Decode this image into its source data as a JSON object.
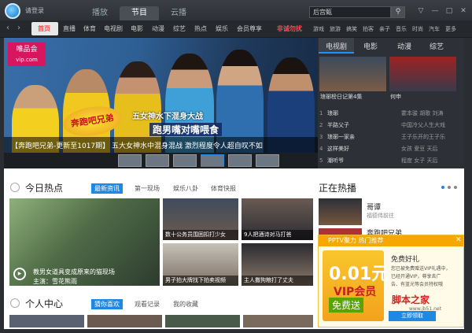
{
  "titlebar": {
    "login": "请登录",
    "tabs": [
      {
        "label": "播放",
        "active": false
      },
      {
        "label": "节目",
        "active": true
      },
      {
        "label": "云播",
        "active": false
      }
    ],
    "search_value": "后宫甄",
    "search_icon": "search-icon"
  },
  "navbar": {
    "items": [
      "首页",
      "直播",
      "体育",
      "电视剧",
      "电影",
      "动漫",
      "综艺",
      "热点",
      "娱乐",
      "会员尊享"
    ],
    "highlight": "非诚勿扰",
    "more": [
      "游戏",
      "旅游",
      "搞笑",
      "拍客",
      "亲子",
      "音乐",
      "时尚",
      "汽车",
      "更多"
    ]
  },
  "banner": {
    "brand_name": "唯品会",
    "brand_url": "vip.com",
    "show_logo": "奔跑吧兄弟",
    "headline1": "五女神水下混身大战",
    "headline2": "跑男嘴对嘴喂食",
    "caption": "【奔跑吧兄弟-更新至1017期】 五大女神水中混身混战 激烈程度令人超自叹不如"
  },
  "right_panel": {
    "tabs": [
      "电视剧",
      "电影",
      "动漫",
      "综艺"
    ],
    "thumbs": [
      {
        "label": "琅琊榜日记第4集"
      },
      {
        "label": "何申"
      }
    ],
    "list": [
      {
        "num": "1",
        "title": "琅琊",
        "desc": "霍本骏 胡歌 刘涛"
      },
      {
        "num": "2",
        "title": "半路父子",
        "desc": "中国冷父人生大戏"
      },
      {
        "num": "3",
        "title": "琅琊一家亲",
        "desc": "王子乐开的王子乐"
      },
      {
        "num": "4",
        "title": "这样美好",
        "desc": "女孩 爱豆 天后"
      },
      {
        "num": "5",
        "title": "潮听爷",
        "desc": "程度 女子 天后"
      }
    ]
  },
  "hot": {
    "title": "今日热点",
    "tabs": [
      {
        "label": "最新资讯",
        "active": true
      },
      {
        "label": "第一现场",
        "active": false
      },
      {
        "label": "娱乐八卦",
        "active": false
      },
      {
        "label": "体育快报",
        "active": false
      }
    ],
    "big_title": "教男女道具变成原来的猫现场",
    "big_sub": "主演：雪花熊雨",
    "tiles": [
      {
        "caption": "数十公务员围困扣打少女"
      },
      {
        "caption": "9人把酒诗对马打爸"
      },
      {
        "caption": "男子拍大牌找下拍卖视频"
      },
      {
        "caption": "主人撒狗粮打了丈夫"
      }
    ]
  },
  "playing": {
    "title": "正在热播",
    "items": [
      {
        "name": "哥谭",
        "desc": "福德伟前往"
      },
      {
        "name": "奔跑吧兄弟",
        "desc": ""
      }
    ]
  },
  "personal": {
    "title": "个人中心",
    "tabs": [
      {
        "label": "猜你喜欢",
        "active": true
      },
      {
        "label": "观看记录",
        "active": false
      },
      {
        "label": "我的收藏",
        "active": false
      }
    ]
  },
  "popup": {
    "header": "PPTV聚力  热门推荐",
    "price": "0.01元",
    "vip": "VIP会员",
    "free": "免费送",
    "title": "免费好礼",
    "lines": [
      "您已被免费赠送VIP礼遇中，",
      "已经开通VIP，尊享去广",
      "告、有蓝光等会员特权哦"
    ],
    "button": "立即领取"
  },
  "watermark": {
    "text": "脚本之家",
    "url": "www.jb51.net"
  },
  "colors": {
    "accent": "#1e88e5",
    "nav_highlight": "#ff4b4b",
    "dark_bg": "#2a2e33"
  }
}
